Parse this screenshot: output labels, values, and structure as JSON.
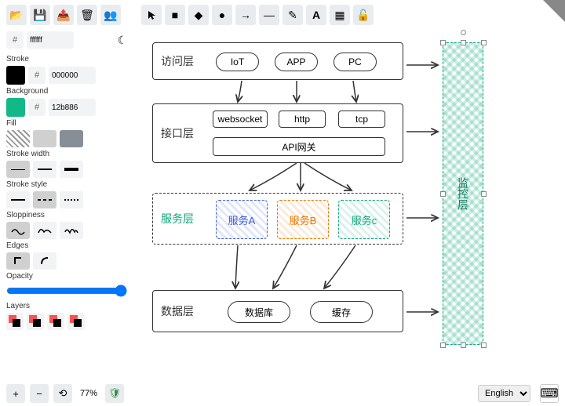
{
  "colors": {
    "fill": "ffffff",
    "stroke": "000000",
    "background": "12b886"
  },
  "labels": {
    "stroke": "Stroke",
    "background": "Background",
    "fill": "Fill",
    "strokeWidth": "Stroke width",
    "strokeStyle": "Stroke style",
    "sloppiness": "Sloppiness",
    "edges": "Edges",
    "opacity": "Opacity",
    "layers": "Layers"
  },
  "zoom": "77%",
  "language": "English",
  "diagram": {
    "layers": {
      "access": "访问层",
      "interface": "接口层",
      "service": "服务层",
      "data": "数据层",
      "monitor": "监控层"
    },
    "nodes": {
      "iot": "IoT",
      "app": "APP",
      "pc": "PC",
      "websocket": "websocket",
      "http": "http",
      "tcp": "tcp",
      "gateway": "API网关",
      "svcA": "服务A",
      "svcB": "服务B",
      "svcC": "服务c",
      "db": "数据库",
      "cache": "缓存"
    }
  }
}
